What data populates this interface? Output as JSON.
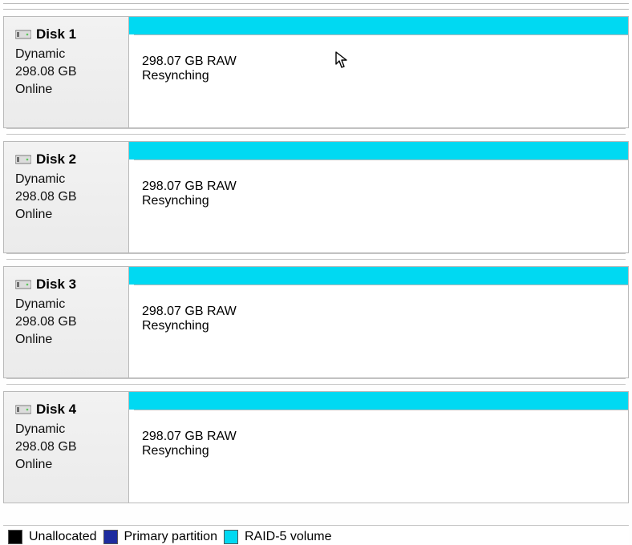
{
  "colors": {
    "raid5": "#00d9f2",
    "primary": "#1e2c9f",
    "unallocated": "#000000"
  },
  "disks": [
    {
      "name": "Disk 1",
      "type": "Dynamic",
      "size": "298.08 GB",
      "status": "Online",
      "vol": {
        "size": "298.07 GB RAW",
        "state": "Resynching"
      }
    },
    {
      "name": "Disk 2",
      "type": "Dynamic",
      "size": "298.08 GB",
      "status": "Online",
      "vol": {
        "size": "298.07 GB RAW",
        "state": "Resynching"
      }
    },
    {
      "name": "Disk 3",
      "type": "Dynamic",
      "size": "298.08 GB",
      "status": "Online",
      "vol": {
        "size": "298.07 GB RAW",
        "state": "Resynching"
      }
    },
    {
      "name": "Disk 4",
      "type": "Dynamic",
      "size": "298.08 GB",
      "status": "Online",
      "vol": {
        "size": "298.07 GB RAW",
        "state": "Resynching"
      }
    }
  ],
  "legend": {
    "unallocated": "Unallocated",
    "primary": "Primary partition",
    "raid5": "RAID-5 volume"
  }
}
